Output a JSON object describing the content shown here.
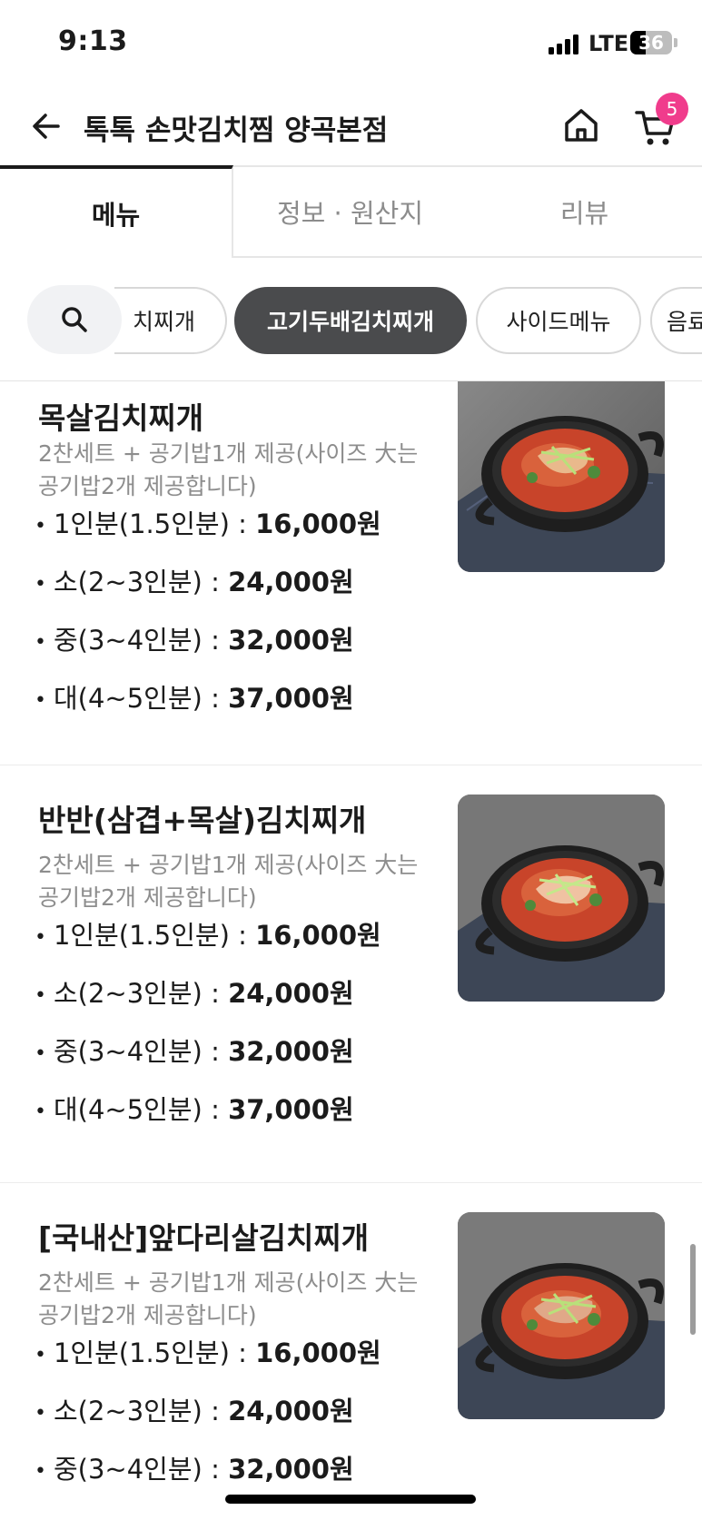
{
  "status_bar": {
    "time": "9:13",
    "network": "LTE",
    "battery_level": "36",
    "battery_fraction": 0.36
  },
  "header": {
    "title": "톡톡 손맛김치찜 양곡본점",
    "cart_count": "5",
    "back_icon": "arrow-left-icon",
    "home_icon": "home-icon",
    "cart_icon": "cart-icon"
  },
  "tabs": [
    {
      "label": "메뉴",
      "active": true
    },
    {
      "label": "정보 · 원산지",
      "active": false
    },
    {
      "label": "리뷰",
      "active": false
    }
  ],
  "categories": [
    {
      "label": "치찌개",
      "active": false
    },
    {
      "label": "고기두배김치찌개",
      "active": true
    },
    {
      "label": "사이드메뉴",
      "active": false
    },
    {
      "label": "음료",
      "active": false
    }
  ],
  "menu_items": [
    {
      "name": "목살김치찌개",
      "description": "2찬세트 + 공기밥1개 제공(사이즈 大는 공기밥2개 제공합니다)",
      "prices": [
        {
          "size": "1인분(1.5인분) : ",
          "price": "16,000원"
        },
        {
          "size": "소(2~3인분) : ",
          "price": "24,000원"
        },
        {
          "size": "중(3~4인분) : ",
          "price": "32,000원"
        },
        {
          "size": "대(4~5인분) : ",
          "price": "37,000원"
        }
      ]
    },
    {
      "name": "반반(삼겹+목살)김치찌개",
      "description": "2찬세트 + 공기밥1개 제공(사이즈 大는 공기밥2개 제공합니다)",
      "prices": [
        {
          "size": "1인분(1.5인분) : ",
          "price": "16,000원"
        },
        {
          "size": "소(2~3인분) : ",
          "price": "24,000원"
        },
        {
          "size": "중(3~4인분) : ",
          "price": "32,000원"
        },
        {
          "size": "대(4~5인분) : ",
          "price": "37,000원"
        }
      ]
    },
    {
      "name": "[국내산]앞다리살김치찌개",
      "description": "2찬세트 + 공기밥1개 제공(사이즈 大는 공기밥2개 제공합니다)",
      "prices": [
        {
          "size": "1인분(1.5인분) : ",
          "price": "16,000원"
        },
        {
          "size": "소(2~3인분) : ",
          "price": "24,000원"
        },
        {
          "size": "중(3~4인분) : ",
          "price": "32,000원"
        }
      ]
    }
  ],
  "colors": {
    "accent_badge": "#f03c8c",
    "active_chip": "#4a4b4d",
    "muted_text": "#8d8d8d"
  }
}
